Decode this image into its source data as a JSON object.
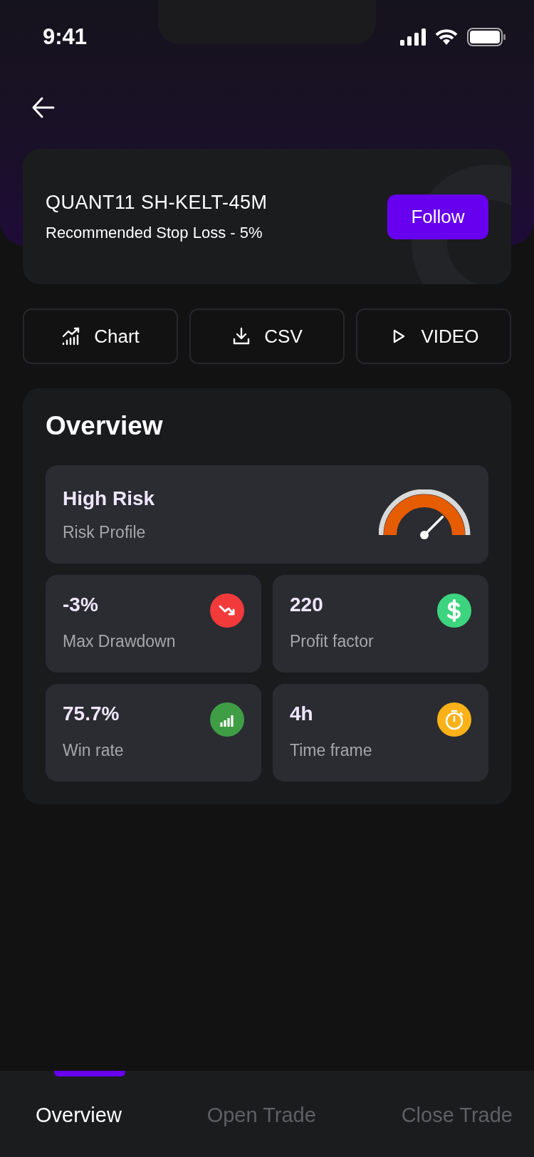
{
  "status_bar": {
    "time": "9:41"
  },
  "strategy": {
    "name": "QUANT11 SH-KELT-45M",
    "stop_loss": "Recommended Stop Loss - 5%",
    "follow_button": "Follow"
  },
  "actions": [
    {
      "kind": "chart",
      "label": "Chart"
    },
    {
      "kind": "download",
      "label": "CSV"
    },
    {
      "kind": "play",
      "label": "VIDEO"
    }
  ],
  "overview": {
    "title": "Overview",
    "risk": {
      "value": "High Risk",
      "label": "Risk Profile"
    },
    "metrics": [
      {
        "kind": "drawdown",
        "value": "-3%",
        "label": "Max Drawdown",
        "color": "#f23a3a"
      },
      {
        "kind": "dollar",
        "value": "220",
        "label": "Profit factor",
        "color": "#3dd47f"
      },
      {
        "kind": "bars",
        "value": "75.7%",
        "label": "Win rate",
        "color": "#3f9e45"
      },
      {
        "kind": "timer",
        "value": "4h",
        "label": "Time frame",
        "color": "#fbb118"
      }
    ]
  },
  "tabs": [
    {
      "label": "Overview",
      "selected": true
    },
    {
      "label": "Open Trade",
      "selected": false
    },
    {
      "label": "Close Trade",
      "selected": false
    }
  ]
}
